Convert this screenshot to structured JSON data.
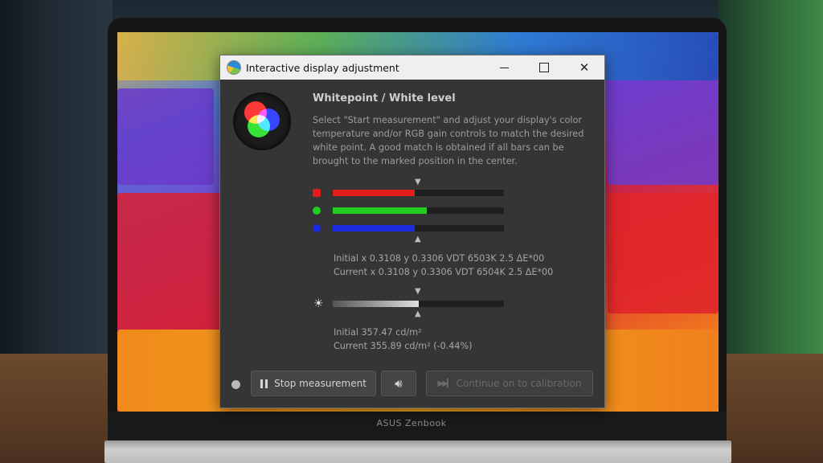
{
  "window": {
    "title": "Interactive display adjustment"
  },
  "section": {
    "heading": "Whitepoint / White level",
    "description": "Select \"Start measurement\" and adjust your display's color temperature and/or RGB gain controls to match the desired white point. A good match is obtained if all bars can be brought to the marked position in the center."
  },
  "bars": {
    "rgb": [
      {
        "channel": "red",
        "color": "#e11d1d",
        "fraction": 0.48
      },
      {
        "channel": "green",
        "color": "#22cc22",
        "fraction": 0.55
      },
      {
        "channel": "blue",
        "color": "#1a2be0",
        "fraction": 0.48
      }
    ],
    "luminance": {
      "color": "#e0e0e0",
      "fraction": 0.5
    }
  },
  "readout": {
    "initial_xy": "Initial x 0.3108 y 0.3306 VDT 6503K 2.5 ΔE*00",
    "current_xy": "Current x 0.3108 y 0.3306 VDT 6504K 2.5 ΔE*00",
    "initial_lum": "Initial 357.47 cd/m²",
    "current_lum": "Current 355.89 cd/m² (-0.44%)"
  },
  "buttons": {
    "stop": "Stop measurement",
    "continue": "Continue on to calibration"
  },
  "device": {
    "brand": "ASUS Zenbook"
  },
  "icons": {
    "logo": "app-logo-icon",
    "minimize": "minimize-icon",
    "maximize": "maximize-icon",
    "close": "close-icon",
    "pause": "pause-icon",
    "speaker": "speaker-icon",
    "skip": "skip-forward-icon",
    "sun": "brightness-icon"
  }
}
